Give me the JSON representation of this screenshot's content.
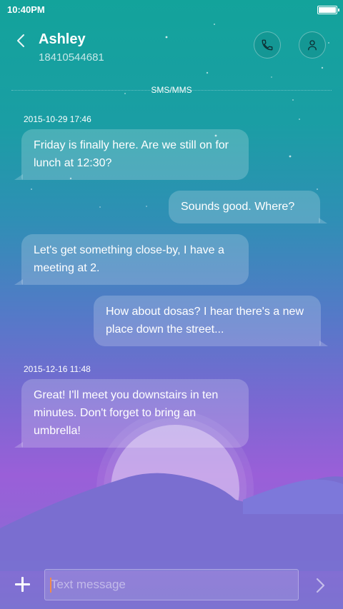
{
  "status_bar": {
    "time": "10:40PM",
    "battery_icon": "battery-icon"
  },
  "header": {
    "contact_name": "Ashley",
    "contact_number": "18410544681",
    "back_icon": "chevron-left-icon",
    "call_icon": "phone-icon",
    "profile_icon": "person-icon"
  },
  "conversation": {
    "channel_label": "SMS/MMS",
    "timestamps": [
      "2015-10-29 17:46",
      "2015-12-16 11:48"
    ],
    "messages": [
      {
        "direction": "incoming",
        "text": "Friday is finally here. Are we still on for lunch at 12:30?"
      },
      {
        "direction": "outgoing",
        "text": "Sounds good. Where?"
      },
      {
        "direction": "incoming",
        "text": "Let's get something close-by, I have a meeting at 2."
      },
      {
        "direction": "outgoing",
        "text": "How about dosas? I hear there's a new place down the street..."
      },
      {
        "direction": "incoming",
        "text": "Great! I'll meet you downstairs in ten minutes. Don't forget to bring an umbrella!"
      }
    ]
  },
  "composer": {
    "placeholder": "Text message",
    "add_icon": "plus-icon",
    "send_icon": "chevron-right-icon"
  }
}
